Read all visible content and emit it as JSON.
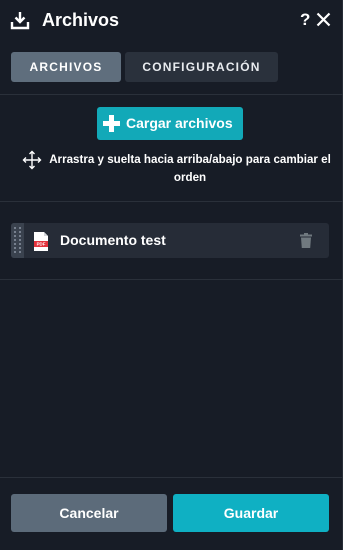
{
  "header": {
    "title": "Archivos",
    "help_label": "?",
    "icon": "download-icon"
  },
  "tabs": [
    {
      "label": "ARCHIVOS",
      "active": true
    },
    {
      "label": "CONFIGURACIÓN",
      "active": false
    }
  ],
  "upload": {
    "label": "Cargar archivos",
    "icon": "plus-icon"
  },
  "drag_hint": {
    "text": "Arrastra y suelta hacia arriba/abajo para cambiar el orden",
    "icon": "move-arrows-icon"
  },
  "files": [
    {
      "name": "Documento test",
      "type_icon": "pdf-file-icon",
      "type_text": "PDF"
    }
  ],
  "footer": {
    "cancel_label": "Cancelar",
    "save_label": "Guardar"
  },
  "colors": {
    "accent": "#12a9b8",
    "save": "#0fb0c3",
    "panel": "#171c26",
    "tab_active": "#5f6e7d",
    "tab_inactive": "#2a313c",
    "cancel": "#5c6b7a"
  }
}
